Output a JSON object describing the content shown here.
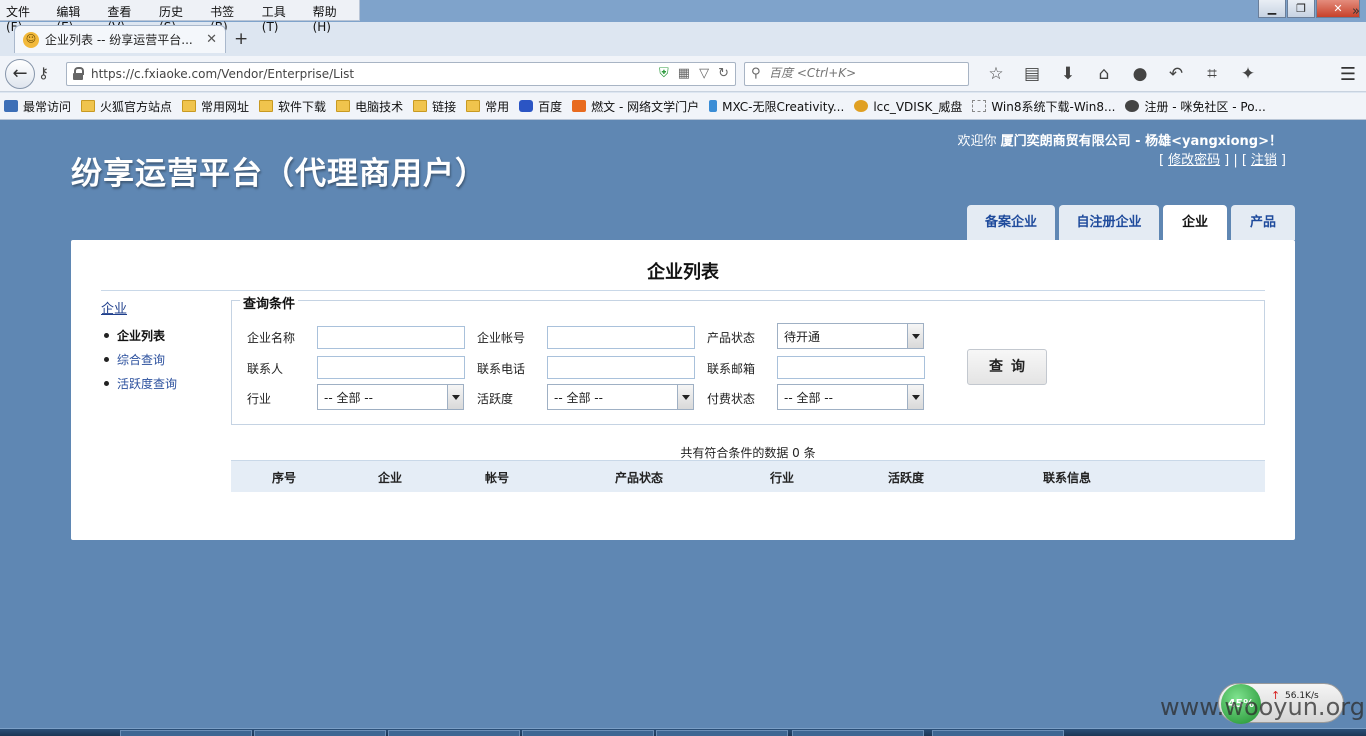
{
  "browser": {
    "menu": [
      "文件(F)",
      "编辑(E)",
      "查看(V)",
      "历史(S)",
      "书签(B)",
      "工具(T)",
      "帮助(H)"
    ],
    "tab_title": "企业列表 -- 纷享运营平台...",
    "url": "https://c.fxiaoke.com/Vendor/Enterprise/List",
    "search_placeholder": "百度 <Ctrl+K>",
    "bookmarks": [
      {
        "label": "最常访问",
        "icon": "site"
      },
      {
        "label": "火狐官方站点",
        "icon": "folder"
      },
      {
        "label": "常用网址",
        "icon": "folder"
      },
      {
        "label": "软件下载",
        "icon": "folder"
      },
      {
        "label": "电脑技术",
        "icon": "folder"
      },
      {
        "label": "链接",
        "icon": "folder"
      },
      {
        "label": "常用",
        "icon": "folder"
      },
      {
        "label": "百度",
        "icon": "paw"
      },
      {
        "label": "燃文 - 网络文学门户",
        "icon": "check"
      },
      {
        "label": "MXC-无限Creativity...",
        "icon": "bottle"
      },
      {
        "label": "lcc_VDISK_威盘",
        "icon": "disk"
      },
      {
        "label": "Win8系统下载-Win8...",
        "icon": "blank"
      },
      {
        "label": "注册 - 咪免社区 - Po...",
        "icon": "cat"
      }
    ]
  },
  "header": {
    "welcome_prefix": "欢迎你",
    "welcome_user": "厦门奕朗商贸有限公司 - 杨雄<yangxiong>！",
    "change_password": "修改密码",
    "logout": "注销",
    "site_title": "纷享运营平台（代理商用户）"
  },
  "nav_tabs": [
    "备案企业",
    "自注册企业",
    "企业",
    "产品"
  ],
  "panel": {
    "title": "企业列表",
    "sidebar": {
      "heading": "企业",
      "items": [
        "企业列表",
        "综合查询",
        "活跃度查询"
      ]
    },
    "query": {
      "legend": "查询条件",
      "labels": {
        "name": "企业名称",
        "account": "企业帐号",
        "product_status": "产品状态",
        "contact": "联系人",
        "phone": "联系电话",
        "email": "联系邮箱",
        "industry": "行业",
        "activity": "活跃度",
        "pay_status": "付费状态"
      },
      "values": {
        "product_status": "待开通",
        "industry": "-- 全部 --",
        "activity": "-- 全部 --",
        "pay_status": "-- 全部 --"
      },
      "button": "查询"
    },
    "result_text": "共有符合条件的数据 0 条",
    "table_headers": [
      "序号",
      "企业",
      "帐号",
      "产品状态",
      "行业",
      "活跃度",
      "联系信息"
    ]
  },
  "overlay": {
    "net_percent": "45%",
    "net_rate": "56.1K/s",
    "watermark": "www.wooyun.org"
  }
}
